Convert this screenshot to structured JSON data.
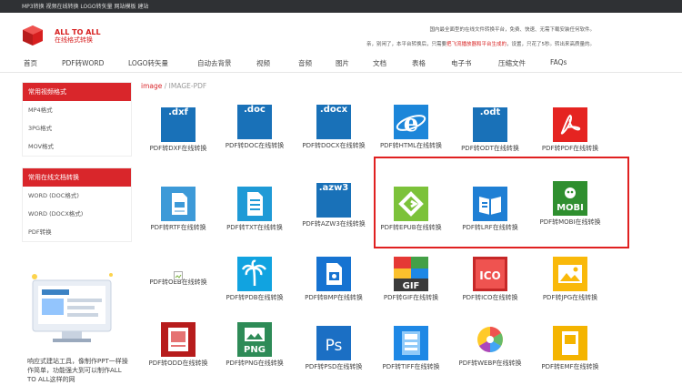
{
  "topbar": {
    "links": "MP3转换 视频在线转换 LOGO转矢量 网站模板 建站"
  },
  "brand": {
    "line1": "ALL TO ALL",
    "line2": "在线格式转换"
  },
  "notice": {
    "line1": "国内最全面型的在线文件转换平台，免费、快速、无需下载安装任何软件。",
    "line2_pre": "亲，别闲了，本平台转换后，只需要",
    "line2_highlight": "把飞流播放器和平台生成的",
    "line2_post": "，设置，只花了5秒。转出来高质量的。"
  },
  "nav": [
    "首页",
    "PDF转WORD",
    "LOGO转矢量",
    "自动去背景",
    "视频",
    "音频",
    "图片",
    "文档",
    "表格",
    "电子书",
    "压缩文件",
    "FAQs"
  ],
  "sidebar": {
    "section1_title": "常用视频格式",
    "section1_items": [
      "MP4格式",
      "3PG格式",
      "MOV格式"
    ],
    "section2_title": "常用在线文档转换",
    "section2_items": [
      "WORD (DOC格式)",
      "WORD (DOCX格式)",
      "PDF转换"
    ]
  },
  "promo": {
    "text": "响应式建站工具，像制作PPT一样操作简单，功能强大到可以制作ALL TO ALL这样的网"
  },
  "breadcrumb": {
    "home": "image",
    "sep": " / ",
    "current": "IMAGE-PDF"
  },
  "tiles": [
    {
      "ext": ".dxf",
      "label": "PDF转DXF在线转换"
    },
    {
      "ext": ".doc",
      "label": "PDF转DOC在线转换"
    },
    {
      "ext": ".docx",
      "label": "PDF转DOCX在线转换"
    },
    {
      "ext": "",
      "label": "PDF转HTML在线转换"
    },
    {
      "ext": ".odt",
      "label": "PDF转ODT在线转换"
    },
    {
      "ext": "",
      "label": "PDF转PDF在线转换"
    },
    {
      "ext": "",
      "label": "PDF转RTF在线转换"
    },
    {
      "ext": "",
      "label": "PDF转TXT在线转换"
    },
    {
      "ext": ".azw3",
      "label": "PDF转AZW3在线转换"
    },
    {
      "ext": "",
      "label": "PDF转EPUB在线转换"
    },
    {
      "ext": "",
      "label": "PDF转LRF在线转换"
    },
    {
      "ext": "MOBI",
      "label": "PDF转MOBI在线转换"
    },
    {
      "ext": "",
      "label": "PDF转OEB在线转换"
    },
    {
      "ext": "",
      "label": "PDF转PDB在线转换"
    },
    {
      "ext": "",
      "label": "PDF转BMP在线转换"
    },
    {
      "ext": "GIF",
      "label": "PDF转GIF在线转换"
    },
    {
      "ext": "ICO",
      "label": "PDF转ICO在线转换"
    },
    {
      "ext": "",
      "label": "PDF转JPG在线转换"
    },
    {
      "ext": "",
      "label": "PDF转ODD在线转换"
    },
    {
      "ext": "PNG",
      "label": "PDF转PNG在线转换"
    },
    {
      "ext": "Ps",
      "label": "PDF转PSD在线转换"
    },
    {
      "ext": "",
      "label": "PDF转TIFF在线转换"
    },
    {
      "ext": "",
      "label": "PDF转WEBP在线转换"
    },
    {
      "ext": "",
      "label": "PDF转EMF在线转换"
    }
  ],
  "colors": {
    "accent": "#d9262b",
    "topbar": "#2f3134",
    "highlight_box": "#e02020"
  }
}
